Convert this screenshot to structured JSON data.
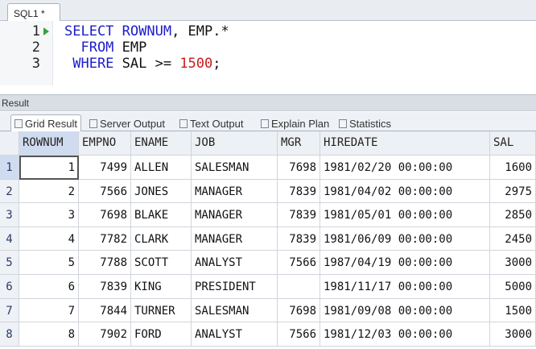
{
  "editor": {
    "tab_label": "SQL1 *",
    "lines": [
      {
        "number": "1",
        "segments": [
          {
            "t": "SELECT ",
            "c": "kw"
          },
          {
            "t": "ROWNUM",
            "c": "kw"
          },
          {
            "t": ", EMP.*",
            "c": "txt"
          }
        ]
      },
      {
        "number": "2",
        "segments": [
          {
            "t": "  FROM ",
            "c": "kw"
          },
          {
            "t": "EMP",
            "c": "txt"
          }
        ]
      },
      {
        "number": "3",
        "segments": [
          {
            "t": " WHERE ",
            "c": "kw"
          },
          {
            "t": "SAL >= ",
            "c": "txt"
          },
          {
            "t": "1500",
            "c": "num"
          },
          {
            "t": ";",
            "c": "txt"
          }
        ]
      }
    ]
  },
  "result": {
    "header": "Result",
    "tabs": [
      {
        "label": "Grid Result",
        "icon": "grid-icon",
        "active": true
      },
      {
        "label": "Server Output",
        "icon": "server-output-icon",
        "active": false
      },
      {
        "label": "Text Output",
        "icon": "text-output-icon",
        "active": false
      },
      {
        "label": "Explain Plan",
        "icon": "explain-plan-icon",
        "active": false
      },
      {
        "label": "Statistics",
        "icon": "statistics-icon",
        "active": false
      }
    ]
  },
  "grid": {
    "columns": [
      "ROWNUM",
      "EMPNO",
      "ENAME",
      "JOB",
      "MGR",
      "HIREDATE",
      "SAL"
    ],
    "rows": [
      [
        "1",
        "7499",
        "ALLEN",
        "SALESMAN",
        "7698",
        "1981/02/20 00:00:00",
        "1600"
      ],
      [
        "2",
        "7566",
        "JONES",
        "MANAGER",
        "7839",
        "1981/04/02 00:00:00",
        "2975"
      ],
      [
        "3",
        "7698",
        "BLAKE",
        "MANAGER",
        "7839",
        "1981/05/01 00:00:00",
        "2850"
      ],
      [
        "4",
        "7782",
        "CLARK",
        "MANAGER",
        "7839",
        "1981/06/09 00:00:00",
        "2450"
      ],
      [
        "5",
        "7788",
        "SCOTT",
        "ANALYST",
        "7566",
        "1987/04/19 00:00:00",
        "3000"
      ],
      [
        "6",
        "7839",
        "KING",
        "PRESIDENT",
        "",
        "1981/11/17 00:00:00",
        "5000"
      ],
      [
        "7",
        "7844",
        "TURNER",
        "SALESMAN",
        "7698",
        "1981/09/08 00:00:00",
        "1500"
      ],
      [
        "8",
        "7902",
        "FORD",
        "ANALYST",
        "7566",
        "1981/12/03 00:00:00",
        "3000"
      ]
    ],
    "row_numbers": [
      "1",
      "2",
      "3",
      "4",
      "5",
      "6",
      "7",
      "8"
    ]
  }
}
